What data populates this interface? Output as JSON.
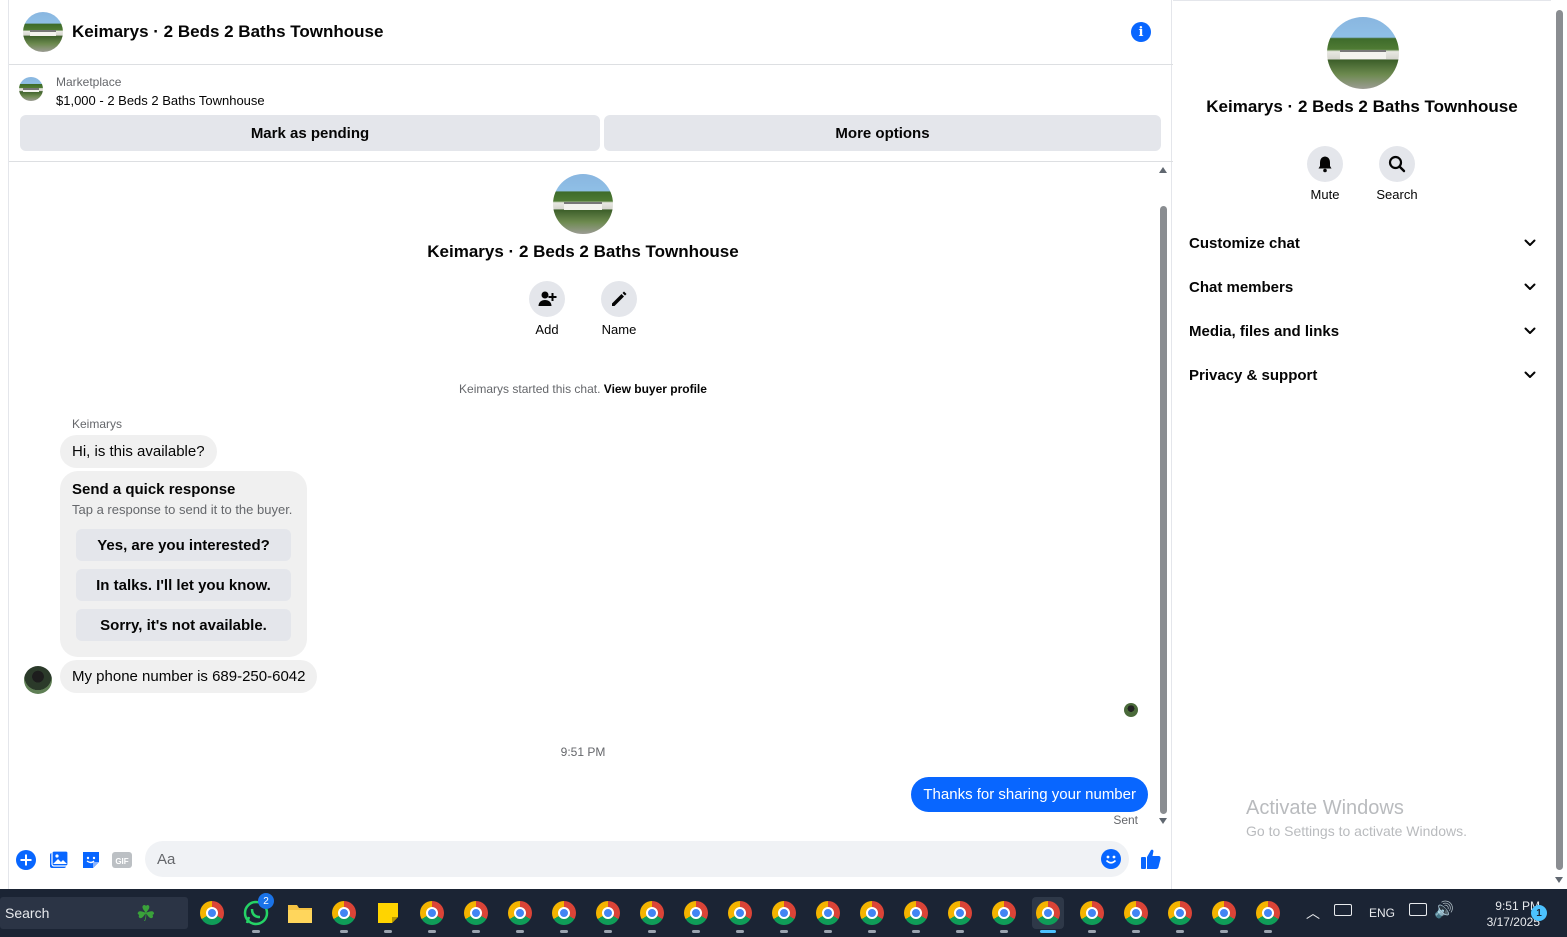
{
  "header": {
    "title": "Keimarys · 2 Beds 2 Baths Townhouse",
    "info_icon": "info-icon"
  },
  "marketplace": {
    "source": "Marketplace",
    "listing": "$1,000 - 2 Beds 2 Baths Townhouse",
    "pending_label": "Mark as pending",
    "more_label": "More options"
  },
  "intro": {
    "title": "Keimarys · 2 Beds 2 Baths Townhouse",
    "add_label": "Add",
    "name_label": "Name",
    "started_text": "Keimarys started this chat.",
    "buyer_profile_link": "View buyer profile"
  },
  "messages": {
    "sender": "Keimarys",
    "first": "Hi, is this available?",
    "quick_title": "Send a quick response",
    "quick_sub": "Tap a response to send it to the buyer.",
    "quick_options": [
      "Yes, are you interested?",
      "In talks. I'll let you know.",
      "Sorry, it's not available."
    ],
    "second": "My phone number is 689-250-6042",
    "timestamp": "9:51 PM",
    "outgoing": "Thanks for sharing your number",
    "status": "Sent"
  },
  "composer": {
    "placeholder": "Aa"
  },
  "panel": {
    "title": "Keimarys · 2 Beds 2 Baths Townhouse",
    "mute_label": "Mute",
    "search_label": "Search",
    "sections": [
      "Customize chat",
      "Chat members",
      "Media, files and links",
      "Privacy & support"
    ]
  },
  "watermark": {
    "title": "Activate Windows",
    "subtitle": "Go to Settings to activate Windows."
  },
  "taskbar": {
    "search_label": "Search",
    "whatsapp_badge": "2",
    "language": "ENG",
    "time": "9:51 PM",
    "date": "3/17/2025",
    "notification_count": "1"
  },
  "colors": {
    "accent": "#0866ff",
    "bubble_in": "#f0f0f0",
    "button_bg": "#e4e6eb",
    "taskbar": "#1b2434"
  }
}
